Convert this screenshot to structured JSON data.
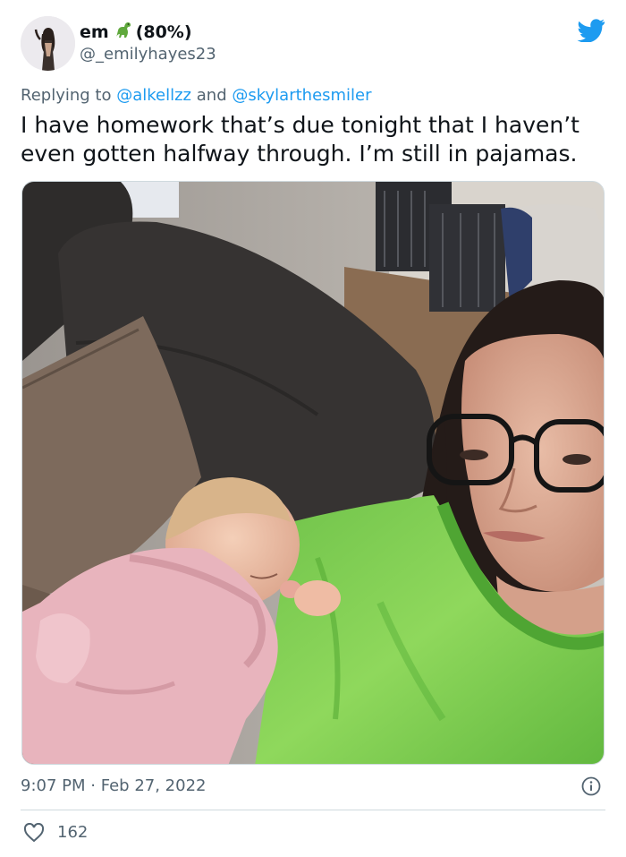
{
  "user": {
    "display_name": "em",
    "name_emoji": "dinosaur-emoji",
    "battery": "(80%)",
    "handle": "@_emilyhayes23"
  },
  "reply": {
    "prefix": "Replying to",
    "mention_1": "@alkellzz",
    "joiner": "and",
    "mention_2": "@skylarthesmiler"
  },
  "tweet": {
    "text": "I have homework that’s due tonight that I haven’t even gotten halfway through. I’m still in pajamas."
  },
  "meta": {
    "time": "9:07 PM",
    "separator": "·",
    "date": "Feb 27, 2022",
    "likes": "162"
  },
  "icons": {
    "brand": "twitter-bird-icon",
    "info": "info-icon",
    "like": "heart-icon"
  },
  "colors": {
    "brand_blue": "#1d9bf0",
    "text_primary": "#0f1419",
    "text_secondary": "#536471",
    "divider": "#cfd9de"
  }
}
